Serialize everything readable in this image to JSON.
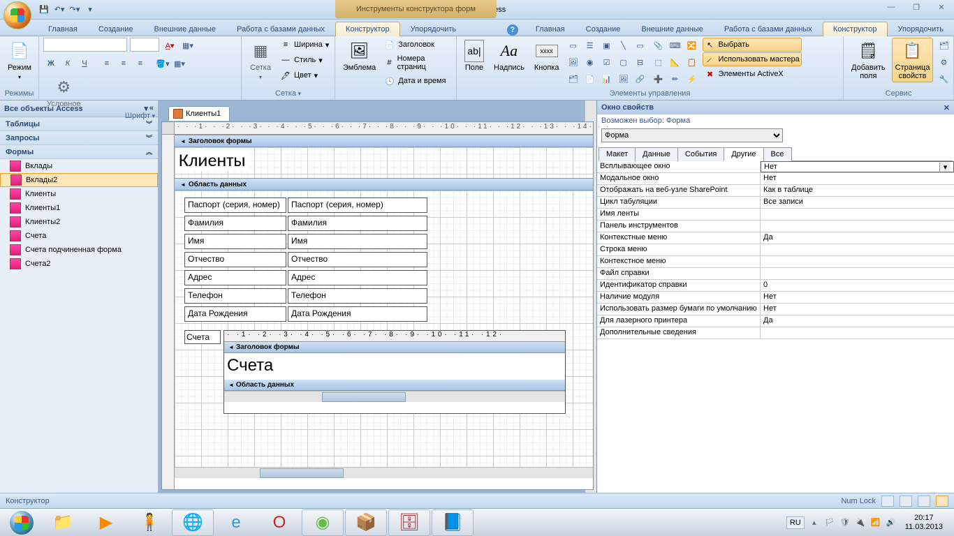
{
  "titlebar": {
    "app": "Microsoft Access",
    "context_tab": "Инструменты конструктора форм"
  },
  "ribbon_tabs": [
    "Главная",
    "Создание",
    "Внешние данные",
    "Работа с базами данных",
    "Конструктор",
    "Упорядочить"
  ],
  "ribbon_active": 4,
  "ribbon": {
    "modes": {
      "label": "Режимы",
      "btn": "Режим"
    },
    "font": {
      "label": "Шрифт",
      "bold": "Ж",
      "italic": "К",
      "under": "Ч"
    },
    "grid": {
      "label": "Сетка",
      "btn_grid": "Сетка",
      "btn_cond": "Условное",
      "width": "Ширина",
      "style": "Стиль",
      "color": "Цвет"
    },
    "emblem": {
      "label": "",
      "btn": "Эмблема",
      "title": "Заголовок",
      "pages": "Номера страниц",
      "datetime": "Дата и время"
    },
    "controls": {
      "label": "Элементы управления",
      "field": "Поле",
      "labelc": "Надпись",
      "button": "Кнопка",
      "select": "Выбрать",
      "wizard": "Использовать мастера",
      "activex": "Элементы ActiveX"
    },
    "tools": {
      "label": "Сервис",
      "addf": "Добавить\nполя",
      "props": "Страница\nсвойств"
    }
  },
  "navpane": {
    "title": "Все объекты Access",
    "groups": [
      {
        "name": "Таблицы",
        "open": false
      },
      {
        "name": "Запросы",
        "open": false
      },
      {
        "name": "Формы",
        "open": true,
        "items": [
          "Вклады",
          "Вклады2",
          "Клиенты",
          "Клиенты1",
          "Клиенты2",
          "Счета",
          "Счета подчиненная форма",
          "Счета2"
        ]
      }
    ],
    "selected": "Вклады2"
  },
  "document": {
    "tab": "Клиенты1",
    "sections": {
      "header": "Заголовок формы",
      "detail": "Область данных"
    },
    "title": "Клиенты",
    "fields": [
      {
        "label": "Паспорт (серия, номер)",
        "ctrl": "Паспорт (серия, номер)"
      },
      {
        "label": "Фамилия",
        "ctrl": "Фамилия"
      },
      {
        "label": "Имя",
        "ctrl": "Имя"
      },
      {
        "label": "Отчество",
        "ctrl": "Отчество"
      },
      {
        "label": "Адрес",
        "ctrl": "Адрес"
      },
      {
        "label": "Телефон",
        "ctrl": "Телефон"
      },
      {
        "label": "Дата Рождения",
        "ctrl": "Дата Рождения"
      }
    ],
    "subform": {
      "label": "Счета",
      "title": "Счета",
      "header": "Заголовок формы",
      "detail": "Область данных"
    }
  },
  "propsheet": {
    "title": "Окно свойств",
    "subtitle": "Возможен выбор: Форма",
    "selector": "Форма",
    "tabs": [
      "Макет",
      "Данные",
      "События",
      "Другие",
      "Все"
    ],
    "active_tab": 3,
    "rows": [
      {
        "k": "Всплывающее окно",
        "v": "Нет",
        "sel": true
      },
      {
        "k": "Модальное окно",
        "v": "Нет"
      },
      {
        "k": "Отображать на веб-узле SharePoint",
        "v": "Как в таблице"
      },
      {
        "k": "Цикл табуляции",
        "v": "Все записи"
      },
      {
        "k": "Имя ленты",
        "v": ""
      },
      {
        "k": "Панель инструментов",
        "v": ""
      },
      {
        "k": "Контекстные меню",
        "v": "Да"
      },
      {
        "k": "Строка меню",
        "v": ""
      },
      {
        "k": "Контекстное меню",
        "v": ""
      },
      {
        "k": "Файл справки",
        "v": ""
      },
      {
        "k": "Идентификатор справки",
        "v": "0"
      },
      {
        "k": "Наличие модуля",
        "v": "Нет"
      },
      {
        "k": "Использовать размер бумаги по умолчанию",
        "v": "Нет"
      },
      {
        "k": "Для лазерного принтера",
        "v": "Да"
      },
      {
        "k": "Дополнительные сведения",
        "v": ""
      }
    ]
  },
  "statusbar": {
    "mode": "Конструктор",
    "numlock": "Num Lock"
  },
  "taskbar": {
    "lang": "RU",
    "time": "20:17",
    "date": "11.03.2013"
  }
}
